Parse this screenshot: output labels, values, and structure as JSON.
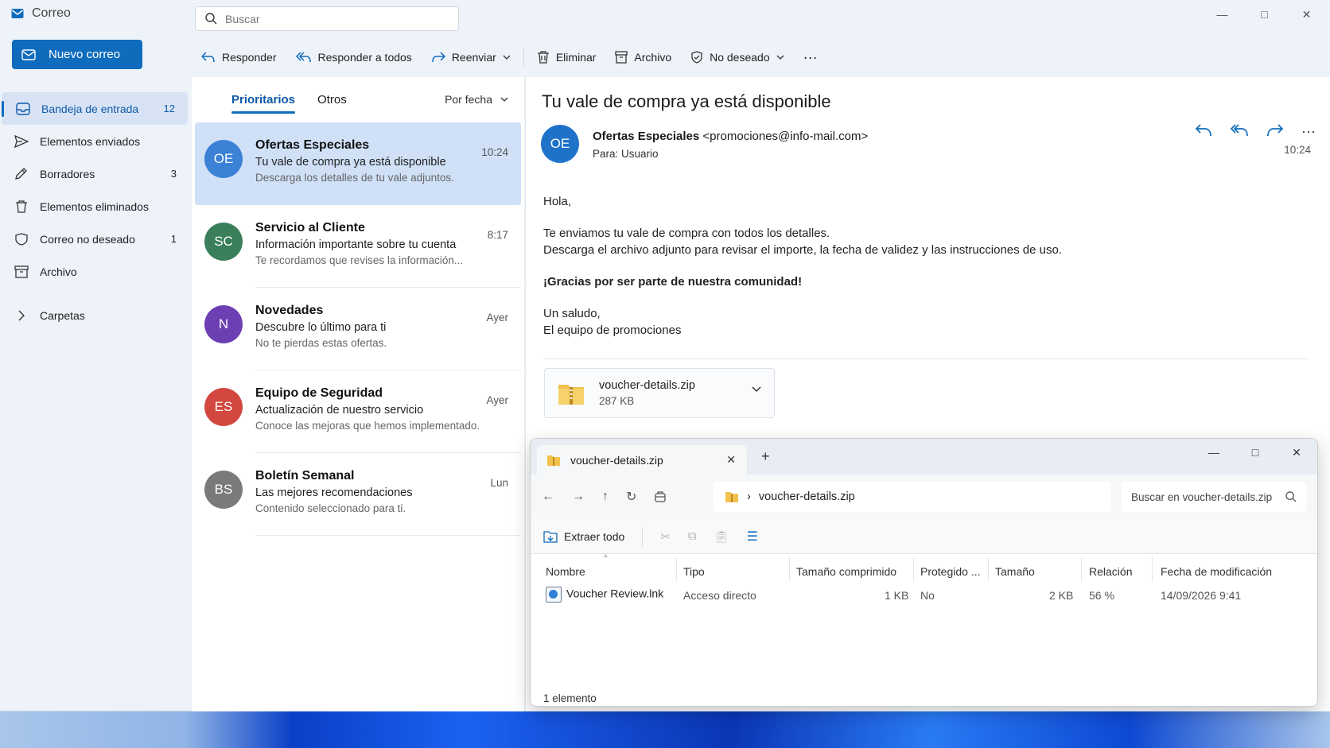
{
  "app": {
    "title": "Correo",
    "search_placeholder": "Buscar"
  },
  "window_controls": {
    "minimize": "—",
    "maximize": "□",
    "close": "✕"
  },
  "new_mail": {
    "label": "Nuevo correo"
  },
  "nav": [
    {
      "label": "Bandeja de entrada",
      "count": "12",
      "icon": "inbox-icon",
      "active": true
    },
    {
      "label": "Elementos enviados",
      "count": "",
      "icon": "send-icon"
    },
    {
      "label": "Borradores",
      "count": "3",
      "icon": "draft-icon"
    },
    {
      "label": "Elementos eliminados",
      "count": "",
      "icon": "trash-icon"
    },
    {
      "label": "Correo no deseado",
      "count": "1",
      "icon": "junk-icon"
    },
    {
      "label": "Archivo",
      "count": "",
      "icon": "archive-icon"
    }
  ],
  "folders_label": "Carpetas",
  "toolbar": {
    "reply": "Responder",
    "reply_all": "Responder a todos",
    "forward": "Reenviar",
    "delete": "Eliminar",
    "archive": "Archivo",
    "junk": "No deseado",
    "more": "···"
  },
  "list": {
    "tab_focused": "Prioritarios",
    "tab_other": "Otros",
    "sort": "Por fecha",
    "messages": [
      {
        "initials": "OE",
        "color": "#3b82d6",
        "sender": "Ofertas Especiales",
        "subject": "Tu vale de compra ya está disponible",
        "preview": "Descarga los detalles de tu vale adjuntos.",
        "time": "10:24",
        "selected": true
      },
      {
        "initials": "SC",
        "color": "#3a7f5a",
        "sender": "Servicio al Cliente",
        "subject": "Información importante sobre tu cuenta",
        "preview": "Te recordamos que revises la información...",
        "time": "8:17"
      },
      {
        "initials": "N",
        "color": "#6c3fb3",
        "sender": "Novedades",
        "subject": "Descubre lo último para ti",
        "preview": "No te pierdas estas ofertas.",
        "time": "Ayer"
      },
      {
        "initials": "ES",
        "color": "#d2473f",
        "sender": "Equipo de Seguridad",
        "subject": "Actualización de nuestro servicio",
        "preview": "Conoce las mejoras que hemos implementado.",
        "time": "Ayer"
      },
      {
        "initials": "BS",
        "color": "#7a7a7a",
        "sender": "Boletín Semanal",
        "subject": "Las mejores recomendaciones",
        "preview": "Contenido seleccionado para ti.",
        "time": "Lun"
      }
    ]
  },
  "reading": {
    "subject": "Tu vale de compra ya está disponible",
    "avatar": "OE",
    "sender_name": "Ofertas Especiales",
    "sender_email": "<promociones@info-mail.com>",
    "to_label": "Para:",
    "to_value": "Usuario",
    "time": "10:24",
    "greeting": "Hola,",
    "line1": "Te enviamos tu vale de compra con todos los detalles.",
    "line2": "Descarga el archivo adjunto para revisar el importe, la fecha de validez y las instrucciones de uso.",
    "thanks": "¡Gracias por ser parte de nuestra comunidad!",
    "closing1": "Un saludo,",
    "closing2": "El equipo de promociones",
    "attachment": {
      "name": "voucher-details.zip",
      "size": "287 KB"
    }
  },
  "explorer": {
    "tab_title": "voucher-details.zip",
    "address": "voucher-details.zip",
    "search_placeholder": "Buscar en voucher-details.zip",
    "extract_all": "Extraer todo",
    "columns": [
      "Nombre",
      "Tipo",
      "Tamaño comprimido",
      "Protegido ...",
      "Tamaño",
      "Relación",
      "Fecha de modificación"
    ],
    "rows": [
      {
        "name": "Voucher Review.lnk",
        "type": "Acceso directo",
        "compressed": "1 KB",
        "protected": "No",
        "size": "2 KB",
        "ratio": "56 %",
        "modified": "14/09/2026 9:41"
      }
    ],
    "status": "1 elemento"
  },
  "colors": {
    "accent": "#0f6cbd",
    "selected": "#cfe0f7"
  }
}
